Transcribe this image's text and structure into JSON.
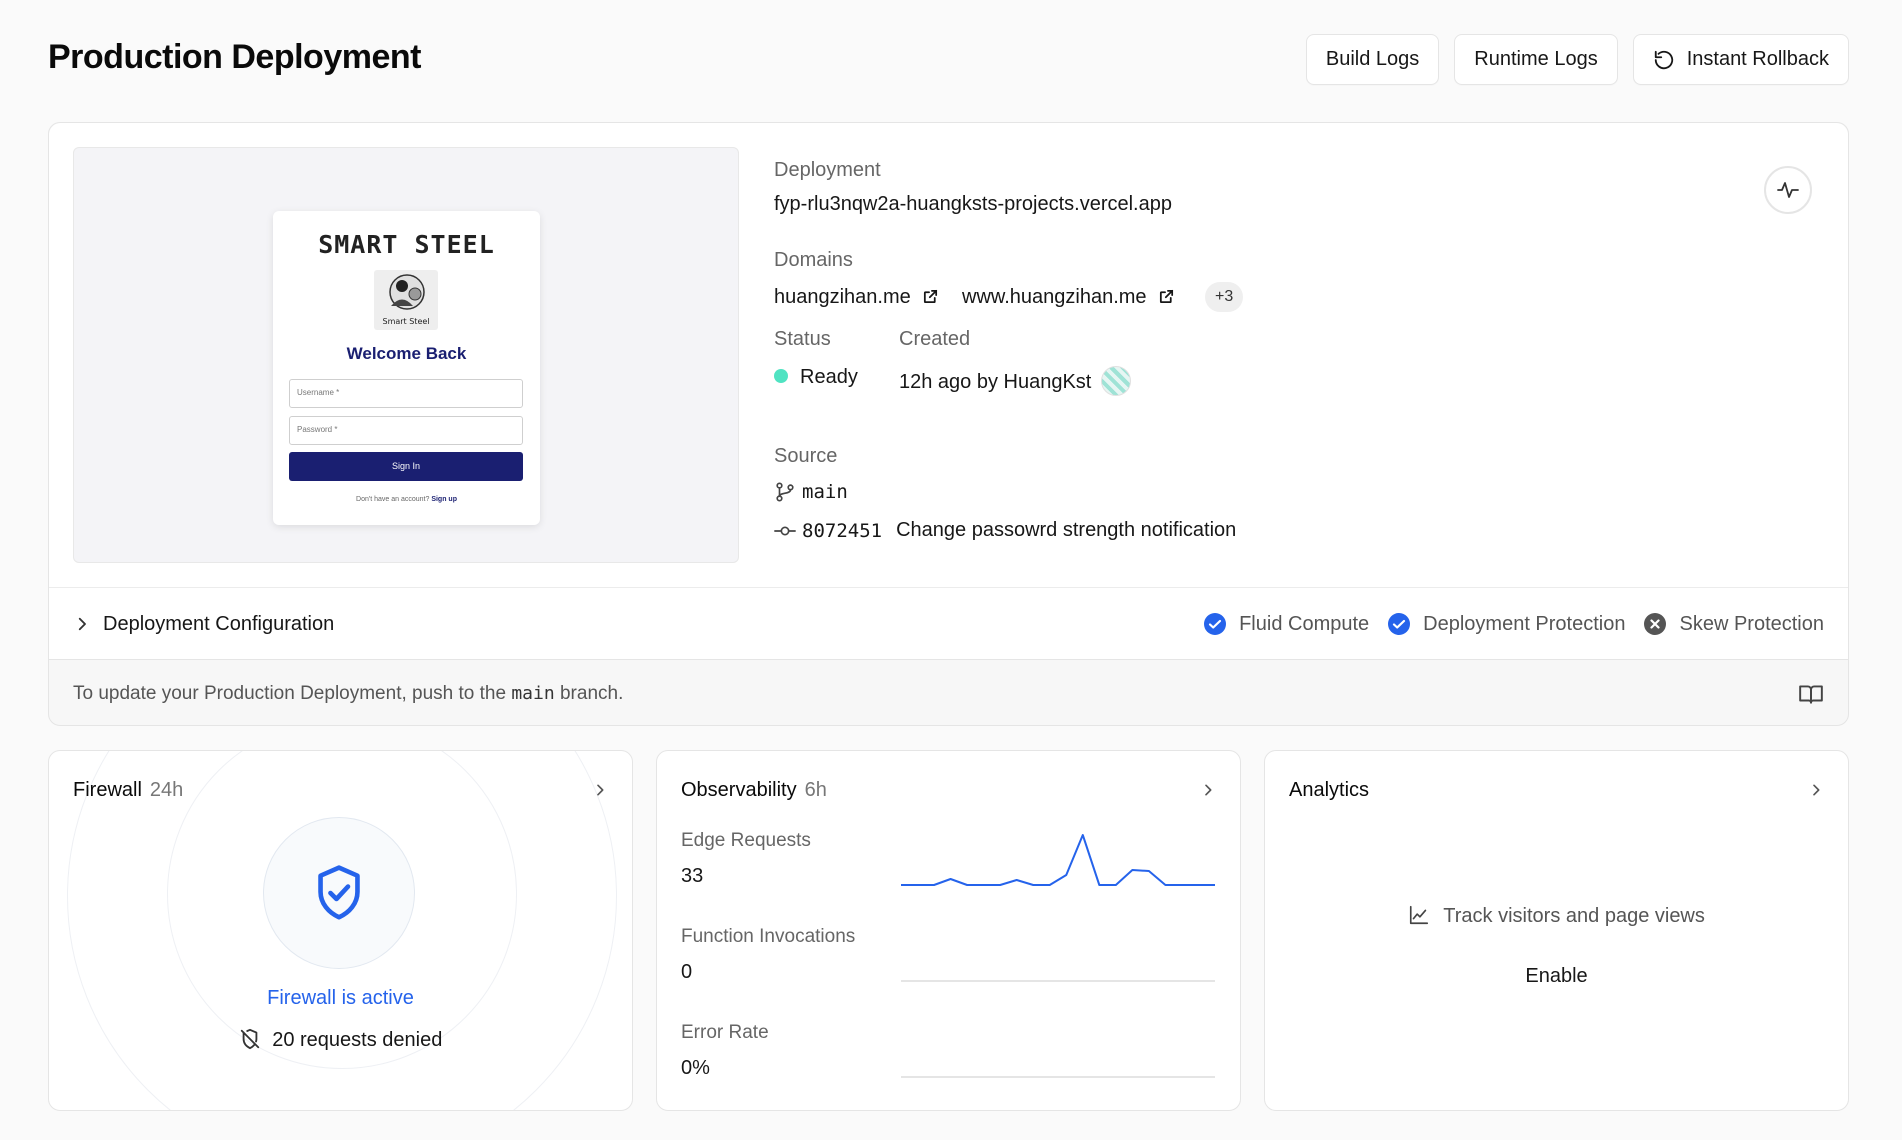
{
  "header": {
    "title": "Production Deployment",
    "build_logs": "Build Logs",
    "runtime_logs": "Runtime Logs",
    "instant_rollback": "Instant Rollback"
  },
  "preview": {
    "brand": "SMART STEEL",
    "logo_caption": "Smart Steel",
    "welcome": "Welcome Back",
    "username_placeholder": "Username *",
    "password_placeholder": "Password *",
    "sign_in": "Sign In",
    "signup_prompt": "Don't have an account?",
    "signup_link": "Sign up"
  },
  "deployment": {
    "deployment_label": "Deployment",
    "url": "fyp-rlu3nqw2a-huangksts-projects.vercel.app",
    "domains_label": "Domains",
    "domains": [
      "huangzihan.me",
      "www.huangzihan.me"
    ],
    "domains_more": "+3",
    "status_label": "Status",
    "status": "Ready",
    "status_color": "#50e3c2",
    "created_label": "Created",
    "created": "12h ago by HuangKst",
    "source_label": "Source",
    "branch": "main",
    "commit_hash": "8072451",
    "commit_message": "Change passowrd strength notification"
  },
  "config": {
    "title": "Deployment Configuration",
    "features": [
      {
        "label": "Fluid Compute",
        "enabled": true
      },
      {
        "label": "Deployment Protection",
        "enabled": true
      },
      {
        "label": "Skew Protection",
        "enabled": false
      }
    ]
  },
  "update_note": {
    "prefix": "To update your Production Deployment, push to the",
    "branch": "main",
    "suffix": "branch."
  },
  "firewall": {
    "title": "Firewall",
    "period": "24h",
    "status": "Firewall is active",
    "denied": "20 requests denied"
  },
  "observability": {
    "title": "Observability",
    "period": "6h",
    "metrics": [
      {
        "label": "Edge Requests",
        "value": "33"
      },
      {
        "label": "Function Invocations",
        "value": "0"
      },
      {
        "label": "Error Rate",
        "value": "0%"
      }
    ]
  },
  "chart_data": {
    "type": "line",
    "series": [
      {
        "values": [
          0,
          0,
          0,
          0.12,
          0,
          0,
          0,
          0.1,
          0,
          0,
          0.2,
          1.0,
          0,
          0,
          0.3,
          0.28,
          0,
          0,
          0,
          0
        ]
      },
      {
        "values": [
          0,
          0,
          0,
          0,
          0,
          0,
          0,
          0,
          0,
          0,
          0,
          0,
          0,
          0,
          0,
          0,
          0,
          0,
          0,
          0
        ]
      },
      {
        "values": [
          0,
          0,
          0,
          0,
          0,
          0,
          0,
          0,
          0,
          0,
          0,
          0,
          0,
          0,
          0,
          0,
          0,
          0,
          0,
          0
        ]
      }
    ],
    "colors": [
      "#2563eb",
      "#e5e5e5",
      "#e5e5e5"
    ]
  },
  "analytics": {
    "title": "Analytics",
    "track": "Track visitors and page views",
    "enable": "Enable"
  },
  "colors": {
    "accent": "#2563eb",
    "brand_navy": "#1a1f71"
  }
}
